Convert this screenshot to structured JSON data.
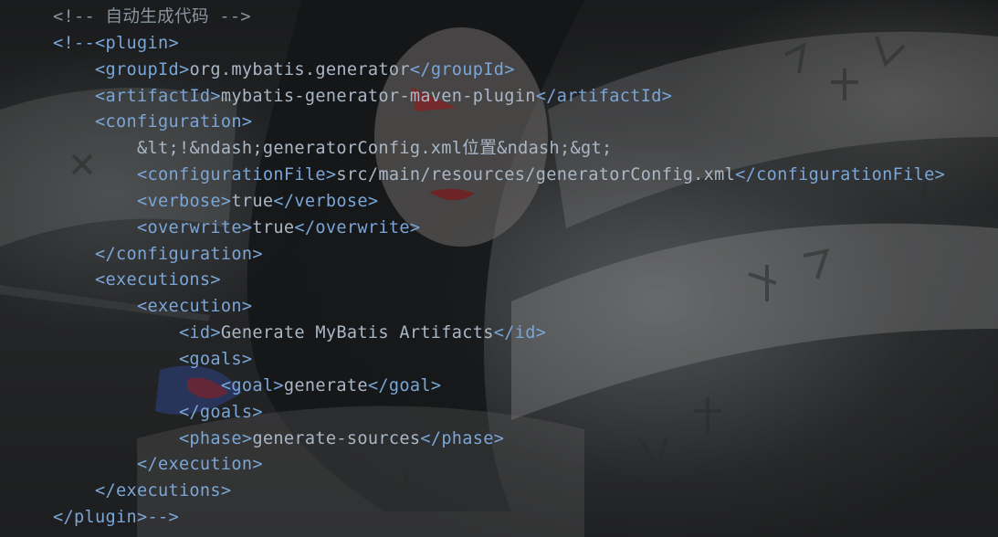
{
  "editor": {
    "language": "xml",
    "lines": [
      {
        "indent": "",
        "parts": [
          {
            "t": "<!-- 自动生成代码 -->",
            "c": "cmt"
          }
        ]
      },
      {
        "indent": "",
        "parts": [
          {
            "t": "<!--<plugin>",
            "c": "tag"
          }
        ]
      },
      {
        "indent": "    ",
        "parts": [
          {
            "t": "<groupId>",
            "c": "tag"
          },
          {
            "t": "org.mybatis.generator",
            "c": "txt"
          },
          {
            "t": "</groupId>",
            "c": "tag"
          }
        ]
      },
      {
        "indent": "    ",
        "parts": [
          {
            "t": "<artifactId>",
            "c": "tag"
          },
          {
            "t": "mybatis-generator-maven-plugin",
            "c": "txt"
          },
          {
            "t": "</artifactId>",
            "c": "tag"
          }
        ]
      },
      {
        "indent": "    ",
        "parts": [
          {
            "t": "<configuration>",
            "c": "tag"
          }
        ]
      },
      {
        "indent": "        ",
        "parts": [
          {
            "t": "&lt;!&ndash;generatorConfig.xml位置&ndash;&gt;",
            "c": "txt"
          }
        ]
      },
      {
        "indent": "        ",
        "parts": [
          {
            "t": "<configurationFile>",
            "c": "tag"
          },
          {
            "t": "src/main/resources/generatorConfig.xml",
            "c": "txt"
          },
          {
            "t": "</configurationFile>",
            "c": "tag"
          }
        ]
      },
      {
        "indent": "        ",
        "parts": [
          {
            "t": "<verbose>",
            "c": "tag"
          },
          {
            "t": "true",
            "c": "txt"
          },
          {
            "t": "</verbose>",
            "c": "tag"
          }
        ]
      },
      {
        "indent": "        ",
        "parts": [
          {
            "t": "<overwrite>",
            "c": "tag"
          },
          {
            "t": "true",
            "c": "txt"
          },
          {
            "t": "</overwrite>",
            "c": "tag"
          }
        ]
      },
      {
        "indent": "    ",
        "parts": [
          {
            "t": "</configuration>",
            "c": "tag"
          }
        ]
      },
      {
        "indent": "    ",
        "parts": [
          {
            "t": "<executions>",
            "c": "tag"
          }
        ]
      },
      {
        "indent": "        ",
        "parts": [
          {
            "t": "<execution>",
            "c": "tag"
          }
        ]
      },
      {
        "indent": "            ",
        "parts": [
          {
            "t": "<id>",
            "c": "tag"
          },
          {
            "t": "Generate MyBatis Artifacts",
            "c": "txt"
          },
          {
            "t": "</id>",
            "c": "tag"
          }
        ]
      },
      {
        "indent": "            ",
        "parts": [
          {
            "t": "<goals>",
            "c": "tag"
          }
        ]
      },
      {
        "indent": "                ",
        "parts": [
          {
            "t": "<goal>",
            "c": "tag"
          },
          {
            "t": "generate",
            "c": "txt"
          },
          {
            "t": "</goal>",
            "c": "tag"
          }
        ]
      },
      {
        "indent": "            ",
        "parts": [
          {
            "t": "</goals>",
            "c": "tag"
          }
        ]
      },
      {
        "indent": "            ",
        "parts": [
          {
            "t": "<phase>",
            "c": "tag"
          },
          {
            "t": "generate-sources",
            "c": "txt"
          },
          {
            "t": "</phase>",
            "c": "tag"
          }
        ]
      },
      {
        "indent": "        ",
        "parts": [
          {
            "t": "</execution>",
            "c": "tag"
          }
        ]
      },
      {
        "indent": "    ",
        "parts": [
          {
            "t": "</executions>",
            "c": "tag"
          }
        ]
      },
      {
        "indent": "",
        "parts": [
          {
            "t": "</plugin>-->",
            "c": "tag"
          }
        ]
      }
    ]
  },
  "colors": {
    "tag": "#7aa6d8",
    "text": "#a9b7c6",
    "comment": "#8a94a0",
    "background": "#1b1c1d"
  }
}
